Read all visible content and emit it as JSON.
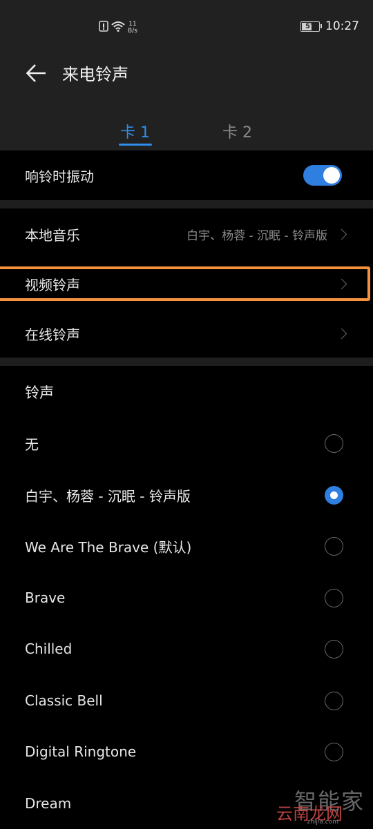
{
  "status": {
    "net_speed_value": "11",
    "net_speed_unit": "B/s",
    "battery": "57",
    "time": "10:27"
  },
  "titlebar": {
    "title": "来电铃声"
  },
  "tabs": [
    {
      "label": "卡 1"
    },
    {
      "label": "卡 2"
    }
  ],
  "vibrate": {
    "label": "响铃时振动"
  },
  "sources": {
    "local_music": {
      "label": "本地音乐",
      "value": "白宇、杨蓉 - 沉眠 - 铃声版"
    },
    "video_ringtone": {
      "label": "视频铃声"
    },
    "online_ringtone": {
      "label": "在线铃声"
    }
  },
  "ringtones": {
    "section_title": "铃声",
    "items": [
      {
        "label": "无",
        "selected": false
      },
      {
        "label": "白宇、杨蓉 - 沉眠 - 铃声版",
        "selected": true
      },
      {
        "label": "We Are The Brave (默认)",
        "selected": false
      },
      {
        "label": "Brave",
        "selected": false
      },
      {
        "label": "Chilled",
        "selected": false
      },
      {
        "label": "Classic Bell",
        "selected": false
      },
      {
        "label": "Digital Ringtone",
        "selected": false
      },
      {
        "label": "Dream",
        "selected": false
      }
    ]
  },
  "watermark": {
    "top": "智能家",
    "bottom": "云南龙网",
    "url": "zhijia.com"
  },
  "colors": {
    "accent": "#2f7fe0",
    "highlight": "#f3913d"
  }
}
